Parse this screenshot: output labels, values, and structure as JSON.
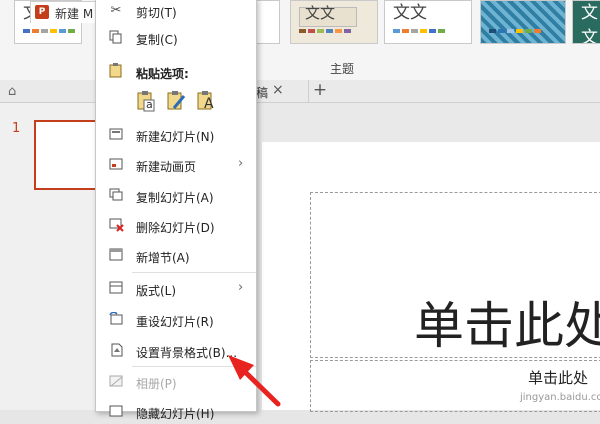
{
  "ribbon": {
    "themes": [
      {
        "text": "文文",
        "style": "plain"
      },
      {
        "text": "文文",
        "style": "label"
      },
      {
        "text": "文文",
        "style": "plain"
      },
      {
        "text": "",
        "style": "pattern"
      },
      {
        "text": "文文",
        "style": "dark"
      }
    ],
    "group_label": "主题"
  },
  "tabs": {
    "active_label": "新建 M",
    "active_app_icon": "P",
    "second_tab_text": "稿",
    "close_glyph": "×",
    "add_glyph": "+"
  },
  "thumbnail": {
    "slide_number": "1"
  },
  "slide": {
    "title_placeholder": "单击此处",
    "subtitle_placeholder": "单击此处"
  },
  "context_menu": {
    "items": [
      {
        "label": "剪切(T)",
        "icon": "scissors-icon"
      },
      {
        "label": "复制(C)",
        "icon": "copy-icon"
      },
      {
        "label": "新建幻灯片(N)",
        "icon": "new-slide-icon"
      },
      {
        "label": "新建动画页",
        "icon": "new-animation-page-icon",
        "submenu": true
      },
      {
        "label": "复制幻灯片(A)",
        "icon": "duplicate-slide-icon"
      },
      {
        "label": "删除幻灯片(D)",
        "icon": "delete-slide-icon"
      },
      {
        "label": "新增节(A)",
        "icon": "add-section-icon"
      },
      {
        "label": "版式(L)",
        "icon": "layout-icon",
        "submenu": true
      },
      {
        "label": "重设幻灯片(R)",
        "icon": "reset-slide-icon"
      },
      {
        "label": "设置背景格式(B)...",
        "icon": "format-background-icon"
      },
      {
        "label": "相册(P)",
        "icon": "photo-album-icon",
        "disabled": true
      },
      {
        "label": "隐藏幻灯片(H)",
        "icon": "hide-slide-icon"
      }
    ],
    "paste_header": "粘贴选项:",
    "paste_options": [
      "a",
      "",
      "A"
    ],
    "submenu_glyph": "›"
  },
  "colors": {
    "accent": "#c43e1c",
    "arrow": "#e8231f"
  },
  "watermark": {
    "text": "jingyan.baidu.com"
  }
}
